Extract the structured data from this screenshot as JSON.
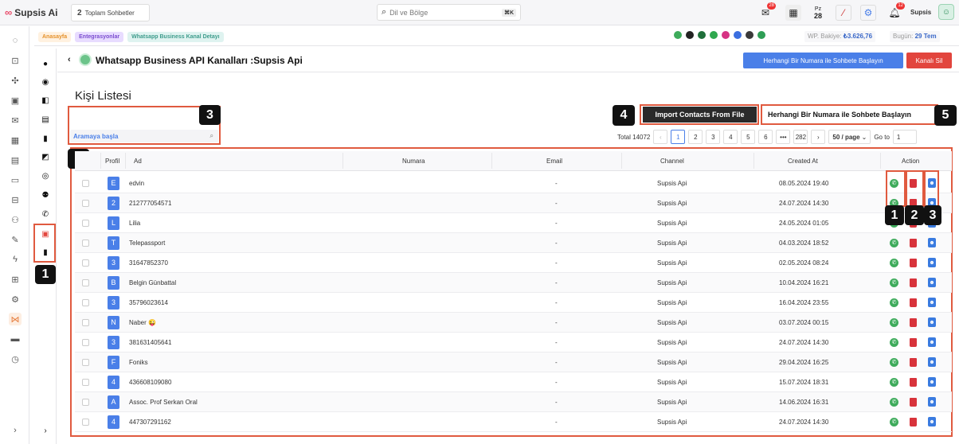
{
  "topbar": {
    "brand": "Supsis Ai",
    "chats_count": "2",
    "chats_label": "Toplam Sohbetler",
    "search_placeholder": "Dil ve Bölge",
    "search_shortcut": "⌘K",
    "mail_badge": "28",
    "date_day": "Pz",
    "date_num": "28",
    "bell_badge": "12",
    "user": "Supsis"
  },
  "breadcrumb": [
    "Anasayfa",
    "Entegrasyonlar",
    "Whatsapp Business Kanal Detayı"
  ],
  "balance": {
    "label": "WP. Bakiye:",
    "value": "₺3.626,76",
    "today_label": "Bugün:",
    "today_value": "29 Tem"
  },
  "header": {
    "title": "Whatsapp Business API Kanalları :Supsis Api",
    "primary_button": "Herhangi Bir Numara ile Sohbete Başlayın",
    "danger_button": "Kanalı Sil"
  },
  "section_title": "Kişi Listesi",
  "search_input_placeholder": "Aramaya başla",
  "import_button": "Import Contacts From File",
  "start_chat_button": "Herhangi Bir Numara ile Sohbete Başlayın",
  "pagination": {
    "total": "Total 14072",
    "prev": "‹",
    "pages": [
      "1",
      "2",
      "3",
      "4",
      "5",
      "6",
      "•••",
      "282"
    ],
    "next": "›",
    "page_size": "50 / page",
    "goto_label": "Go to",
    "goto_value": "1"
  },
  "annotations": [
    "1",
    "2",
    "3",
    "4",
    "5",
    "1",
    "2",
    "3"
  ],
  "table": {
    "columns": [
      "Profil",
      "Ad",
      "Numara",
      "Email",
      "Channel",
      "Created At",
      "Action"
    ],
    "rows": [
      {
        "initial": "E",
        "name": "edvin",
        "email": "-",
        "channel": "Supsis Api",
        "created": "08.05.2024 19:40"
      },
      {
        "initial": "2",
        "name": "212777054571",
        "email": "-",
        "channel": "Supsis Api",
        "created": "24.07.2024 14:30"
      },
      {
        "initial": "L",
        "name": "Lilia",
        "email": "-",
        "channel": "Supsis Api",
        "created": "24.05.2024 01:05"
      },
      {
        "initial": "T",
        "name": "Telepassport",
        "email": "-",
        "channel": "Supsis Api",
        "created": "04.03.2024 18:52"
      },
      {
        "initial": "3",
        "name": "31647852370",
        "email": "-",
        "channel": "Supsis Api",
        "created": "02.05.2024 08:24"
      },
      {
        "initial": "B",
        "name": "Belgin Günbattal",
        "email": "-",
        "channel": "Supsis Api",
        "created": "10.04.2024 16:21"
      },
      {
        "initial": "3",
        "name": "35796023614",
        "email": "-",
        "channel": "Supsis Api",
        "created": "16.04.2024 23:55"
      },
      {
        "initial": "N",
        "name": "Naber 😜",
        "email": "-",
        "channel": "Supsis Api",
        "created": "03.07.2024 00:15"
      },
      {
        "initial": "3",
        "name": "381631405641",
        "email": "-",
        "channel": "Supsis Api",
        "created": "24.07.2024 14:30"
      },
      {
        "initial": "F",
        "name": "Foniks",
        "email": "-",
        "channel": "Supsis Api",
        "created": "29.04.2024 16:25"
      },
      {
        "initial": "4",
        "name": "436608109080",
        "email": "-",
        "channel": "Supsis Api",
        "created": "15.07.2024 18:31"
      },
      {
        "initial": "A",
        "name": "Assoc. Prof Serkan Oral",
        "email": "-",
        "channel": "Supsis Api",
        "created": "14.06.2024 16:31"
      },
      {
        "initial": "4",
        "name": "447307291162",
        "email": "-",
        "channel": "Supsis Api",
        "created": "24.07.2024 14:30"
      }
    ]
  },
  "colors": {
    "primary": "#4a7fe8",
    "danger": "#e2453d",
    "annotation": "#e05a3f",
    "whatsapp": "#3eab5b"
  }
}
